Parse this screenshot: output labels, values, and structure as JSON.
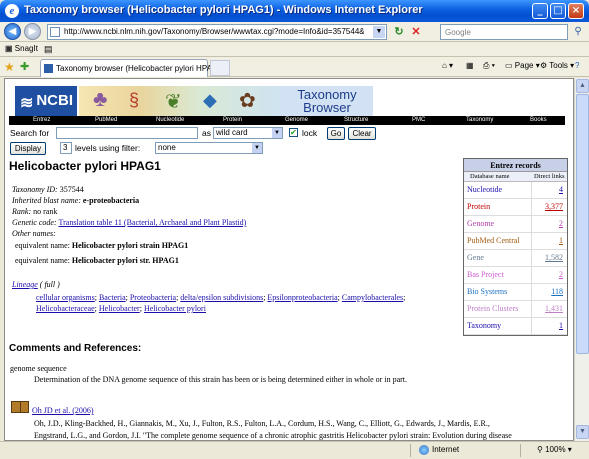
{
  "window": {
    "title": "Taxonomy browser (Helicobacter pylori HPAG1) - Windows Internet Explorer",
    "minimize": "_",
    "maximize": "□",
    "close": "×"
  },
  "address_bar": {
    "url": "http://www.ncbi.nlm.nih.gov/Taxonomy/Browser/wwwtax.cgi?mode=Info&id=357544&lvl=3&p=mapview&p=has",
    "search_placeholder": "Google"
  },
  "links_bar": {
    "snagit": "SnagIt"
  },
  "tab": {
    "title": "Taxonomy browser (Helicobacter pylori HPAG1)"
  },
  "command_bar": {
    "page": "Page",
    "tools": "Tools"
  },
  "banner": {
    "logo": "NCBI",
    "title_line1": "Taxonomy",
    "title_line2": "Browser"
  },
  "nav": [
    "Entrez",
    "PubMed",
    "Nucleotide",
    "Protein",
    "Genome",
    "Structure",
    "PMC",
    "Taxonomy",
    "Books"
  ],
  "search_form": {
    "search_for_label": "Search for",
    "as_label": "as",
    "as_value": "wild card",
    "lock_label": "lock",
    "go": "Go",
    "clear": "Clear",
    "display": "Display",
    "levels_value": "3",
    "levels_label": "levels using filter:",
    "filter_value": "none"
  },
  "organism": {
    "name": "Helicobacter pylori HPAG1",
    "taxonomy_id_label": "Taxonomy ID:",
    "taxonomy_id": "357544",
    "blast_label": "Inherited blast name:",
    "blast_name": "e-proteobacteria",
    "rank_label": "Rank:",
    "rank": "no rank",
    "genetic_code_label": "Genetic code:",
    "genetic_code": "Translation table 11 (Bacterial, Archaeal and Plant Plastid)",
    "other_names_label": "Other names:",
    "equivalent_label": "equivalent name:",
    "equivalent_names": [
      "Helicobacter pylori strain HPAG1",
      "Helicobacter pylori str. HPAG1"
    ],
    "lineage_label": "Lineage",
    "lineage_full": "( full )",
    "lineage_line1": [
      "cellular organisms",
      "Bacteria",
      "Proteobacteria",
      "delta/epsilon subdivisions",
      "Epsilonproteobacteria",
      "Campylobacterales"
    ],
    "lineage_line2": [
      "Helicobacteraceae",
      "Helicobacter",
      "Helicobacter pylori"
    ]
  },
  "entrez": {
    "title": "Entrez records",
    "col_db": "Database name",
    "col_links": "Direct links",
    "rows": [
      {
        "name": "Nucleotide",
        "value": "4",
        "color": "#1a0dab"
      },
      {
        "name": "Protein",
        "value": "3,377",
        "color": "#c00000"
      },
      {
        "name": "Genome",
        "value": "2",
        "color": "#b13aa8"
      },
      {
        "name": "PubMed Central",
        "value": "1",
        "color": "#a05a10"
      },
      {
        "name": "Gene",
        "value": "1,582",
        "color": "#607890"
      },
      {
        "name": "Bas Project",
        "value": "2",
        "color": "#d05ad0"
      },
      {
        "name": "Bio Systems",
        "value": "118",
        "color": "#1a70c0"
      },
      {
        "name": "Protein Clusters",
        "value": "1,431",
        "color": "#c080c8"
      },
      {
        "name": "Taxonomy",
        "value": "1",
        "color": "#1a0dab"
      }
    ]
  },
  "comments": {
    "heading": "Comments and References:",
    "genome_sequence": "genome sequence",
    "genome_text": "Determination of the DNA genome sequence of this strain has been or is being determined either in whole or in part.",
    "ref_link": "Oh JD et al. (2006)",
    "ref_line1": "Oh, J.D., Kling-Backhed, H., Giannakis, M., Xu, J., Fulton, R.S., Fulton, L.A., Cordum, H.S., Wang, C., Elliott, G., Edwards, J., Mardis, E.R.,",
    "ref_line2": "Engstrand, L.G., and Gordon, J.I. \"The complete genome sequence of a chronic atrophic gastritis Helicobacter pylori strain: Evolution during disease"
  },
  "status_bar": {
    "zone": "Internet",
    "zoom": "100%"
  }
}
